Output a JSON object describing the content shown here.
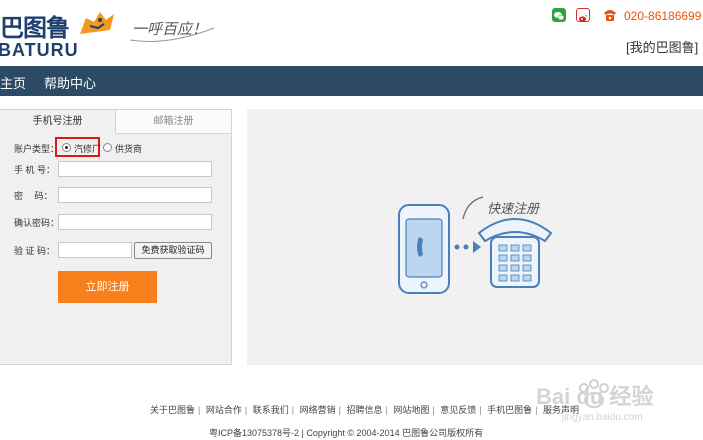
{
  "header": {
    "logo_cn": "巴图鲁",
    "logo_en": "BATURU",
    "slogan": "一呼百应！",
    "phone": "020-86186699",
    "my_link": "[我的巴图鲁]",
    "icons": [
      "wechat-icon",
      "weibo-icon",
      "phone-icon"
    ]
  },
  "nav": {
    "items": [
      {
        "label": "主页"
      },
      {
        "label": "帮助中心"
      }
    ]
  },
  "form": {
    "tabs": [
      {
        "label": "手机号注册",
        "active": true
      },
      {
        "label": "邮箱注册",
        "active": false
      }
    ],
    "account_type": {
      "label": "账户类型：",
      "options": [
        {
          "label": "汽修厂",
          "selected": true
        },
        {
          "label": "供货商",
          "selected": false
        }
      ]
    },
    "fields": {
      "mobile": {
        "label": "手 机 号：",
        "value": ""
      },
      "password": {
        "label": "密　 码：",
        "value": ""
      },
      "confirm": {
        "label": "确认密码：",
        "value": ""
      },
      "code": {
        "label": "验 证 码：",
        "value": ""
      }
    },
    "code_button": "免费获取验证码",
    "submit": "立即注册"
  },
  "illustration": {
    "caption": "快速注册"
  },
  "footer": {
    "links": [
      "关于巴图鲁",
      "网站合作",
      "联系我们",
      "网络营销",
      "招聘信息",
      "网站地图",
      "意见反馈",
      "手机巴图鲁",
      "服务声明"
    ],
    "copyright": "粤ICP备13075378号-2 | Copyright © 2004-2014 巴图鲁公司版权所有"
  },
  "watermark": {
    "text": "Bai du 经验",
    "url": "jingyan.baidu.com"
  },
  "colors": {
    "nav_bg": "#2c4a66",
    "accent": "#f77f1c",
    "phone_text": "#e8540a",
    "highlight_border": "#e2161b"
  }
}
